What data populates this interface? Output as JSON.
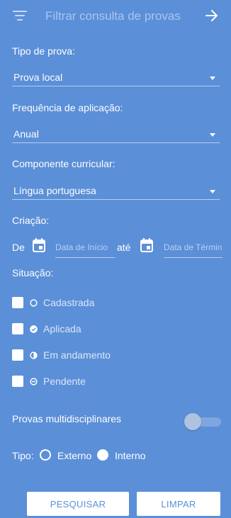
{
  "header": {
    "title": "Filtrar consulta de provas",
    "menu_icon": "filter-list-icon",
    "action_icon": "arrow-right-icon"
  },
  "fields": {
    "tipo_prova": {
      "label": "Tipo de prova:",
      "value": "Prova local"
    },
    "frequencia": {
      "label": "Frequência de aplicação:",
      "value": "Anual"
    },
    "componente": {
      "label": "Componente curricular:",
      "value": "Língua portuguesa"
    }
  },
  "criacao": {
    "label": "Criação:",
    "from_label": "De",
    "to_label": "até",
    "start_placeholder": "Data de Início",
    "end_placeholder": "Data de Término"
  },
  "situacao": {
    "label": "Situação:",
    "options": [
      {
        "label": "Cadastrada",
        "icon": "circle-outline-icon"
      },
      {
        "label": "Aplicada",
        "icon": "check-circle-icon"
      },
      {
        "label": "Em andamento",
        "icon": "half-circle-icon"
      },
      {
        "label": "Pendente",
        "icon": "minus-circle-icon"
      }
    ]
  },
  "multidisciplinares": {
    "label": "Provas multidisciplinares",
    "enabled": false
  },
  "tipo": {
    "label": "Tipo:",
    "options": [
      {
        "label": "Externo",
        "selected": false
      },
      {
        "label": "Interno",
        "selected": true
      }
    ]
  },
  "buttons": {
    "search": "PESQUISAR",
    "clear": "LIMPAR"
  },
  "colors": {
    "background": "#5b8fd8",
    "button_text": "#5b8fd8"
  }
}
